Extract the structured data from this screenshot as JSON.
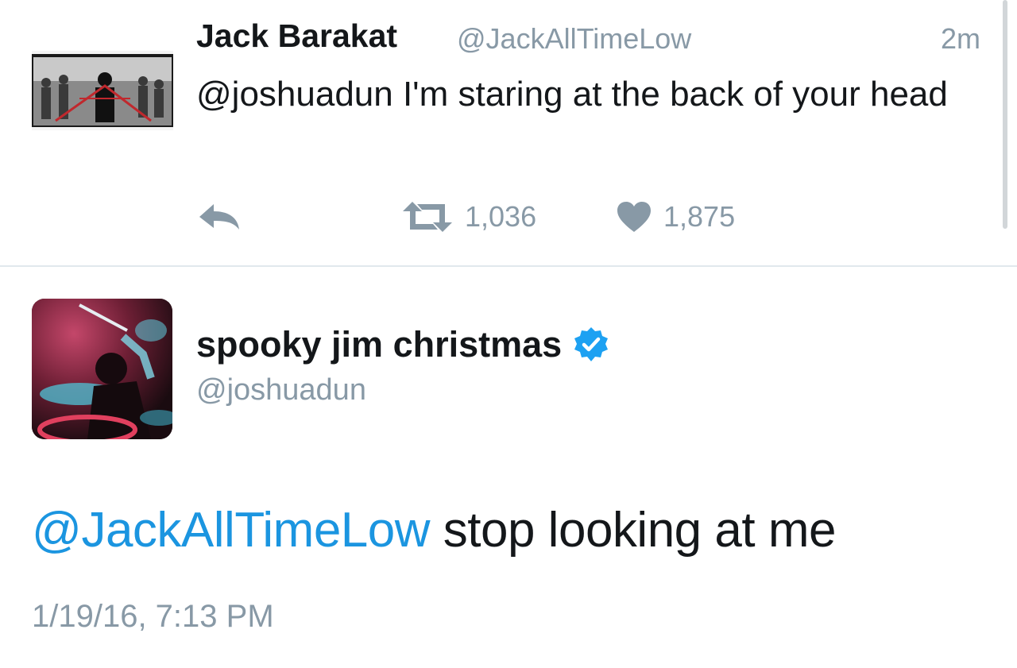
{
  "tweets": [
    {
      "author_name": "Jack Barakat",
      "author_handle": "@JackAllTimeLow",
      "relative_time": "2m",
      "text": "@joshuadun I'm staring at the back of your head",
      "retweets": "1,036",
      "likes": "1,875"
    },
    {
      "author_name": "spooky jim christmas",
      "author_handle": "@joshuadun",
      "verified": true,
      "text_mention": "@JackAllTimeLow",
      "text_body": " stop looking at me",
      "timestamp": "1/19/16, 7:13 PM"
    }
  ],
  "icons": {
    "reply": "reply-icon",
    "retweet": "retweet-icon",
    "like": "heart-icon",
    "verified": "verified-badge-icon"
  },
  "colors": {
    "link": "#1b95e0",
    "meta": "#8899a6",
    "text": "#14171a",
    "verified": "#1da1f2"
  }
}
